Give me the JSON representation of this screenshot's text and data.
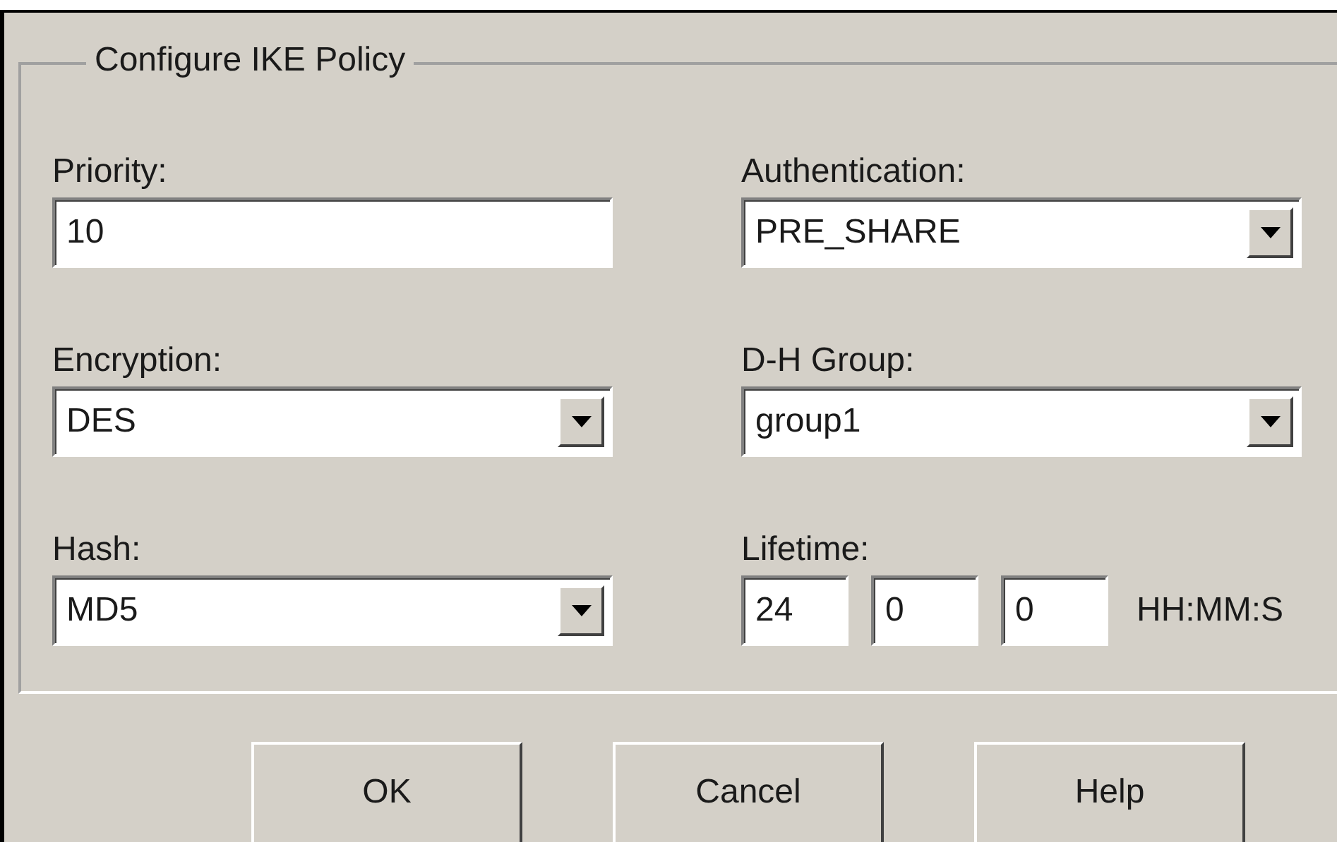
{
  "group": {
    "title": "Configure IKE Policy"
  },
  "fields": [
    {
      "kind": "text",
      "label": "Priority:",
      "value": "10"
    },
    {
      "kind": "select",
      "label": "Authentication:",
      "value": "PRE_SHARE"
    },
    {
      "kind": "select",
      "label": "Encryption:",
      "value": "DES"
    },
    {
      "kind": "select",
      "label": "D-H Group:",
      "value": "group1"
    },
    {
      "kind": "select",
      "label": "Hash:",
      "value": "MD5"
    },
    {
      "kind": "lifetime",
      "label": "Lifetime:",
      "values": [
        "24",
        "0",
        "0"
      ],
      "unit": "HH:MM:S"
    }
  ],
  "buttons": [
    "OK",
    "Cancel",
    "Help"
  ]
}
